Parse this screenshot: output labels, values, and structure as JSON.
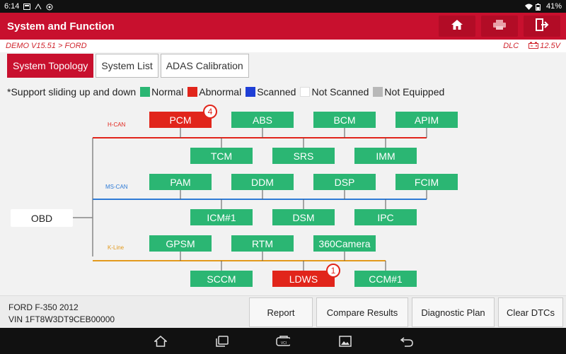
{
  "status_bar": {
    "time": "6:14",
    "battery": "41%"
  },
  "header": {
    "title": "System and Function"
  },
  "breadcrumb": {
    "path": "DEMO V15.51 > FORD",
    "dlc": "DLC",
    "voltage": "12.5V"
  },
  "tabs": [
    {
      "label": "System Topology",
      "active": true
    },
    {
      "label": "System List",
      "active": false
    },
    {
      "label": "ADAS Calibration",
      "active": false
    }
  ],
  "legend": {
    "intro": "*Support sliding up and down",
    "items": [
      {
        "label": "Normal",
        "color": "#2bb673"
      },
      {
        "label": "Abnormal",
        "color": "#e1251b"
      },
      {
        "label": "Scanned",
        "color": "#1f3fd6"
      },
      {
        "label": "Not Scanned",
        "color": "#ffffff"
      },
      {
        "label": "Not Equipped",
        "color": "#b8b8b8"
      }
    ]
  },
  "topology": {
    "obd": "OBD",
    "buses": [
      {
        "name": "H-CAN",
        "color": "#e1251b"
      },
      {
        "name": "MS-CAN",
        "color": "#2f7bd6"
      },
      {
        "name": "K-Line",
        "color": "#e39a1d"
      }
    ],
    "nodes": {
      "pcm": {
        "label": "PCM",
        "status": "Abnormal",
        "badge": "4"
      },
      "abs": {
        "label": "ABS",
        "status": "Normal"
      },
      "bcm": {
        "label": "BCM",
        "status": "Normal"
      },
      "apim": {
        "label": "APIM",
        "status": "Normal"
      },
      "tcm": {
        "label": "TCM",
        "status": "Normal"
      },
      "srs": {
        "label": "SRS",
        "status": "Normal"
      },
      "imm": {
        "label": "IMM",
        "status": "Normal"
      },
      "pam": {
        "label": "PAM",
        "status": "Normal"
      },
      "ddm": {
        "label": "DDM",
        "status": "Normal"
      },
      "dsp": {
        "label": "DSP",
        "status": "Normal"
      },
      "fcim": {
        "label": "FCIM",
        "status": "Normal"
      },
      "icm1": {
        "label": "ICM#1",
        "status": "Normal"
      },
      "dsm": {
        "label": "DSM",
        "status": "Normal"
      },
      "ipc": {
        "label": "IPC",
        "status": "Normal"
      },
      "gpsm": {
        "label": "GPSM",
        "status": "Normal"
      },
      "rtm": {
        "label": "RTM",
        "status": "Normal"
      },
      "camera360": {
        "label": "360Camera",
        "status": "Normal"
      },
      "sccm": {
        "label": "SCCM",
        "status": "Normal"
      },
      "ldws": {
        "label": "LDWS",
        "status": "Abnormal",
        "badge": "1"
      },
      "ccm1": {
        "label": "CCM#1",
        "status": "Normal"
      }
    }
  },
  "vehicle": {
    "model": "FORD F-350 2012",
    "vin": "VIN 1FT8W3DT9CEB00000"
  },
  "footer_buttons": [
    {
      "label": "Report"
    },
    {
      "label": "Compare Results"
    },
    {
      "label": "Diagnostic Plan"
    },
    {
      "label": "Clear DTCs"
    }
  ],
  "icons": {
    "header": [
      "home-icon",
      "print-icon",
      "exit-icon"
    ],
    "nav": [
      "home-nav-icon",
      "recent-apps-icon",
      "vci-icon",
      "screenshot-icon",
      "back-icon"
    ]
  }
}
